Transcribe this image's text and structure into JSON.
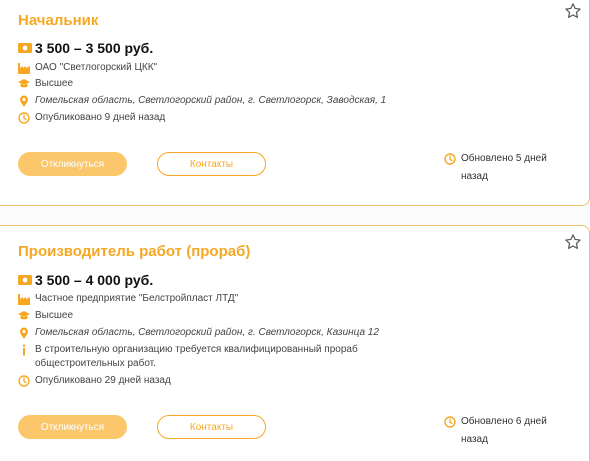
{
  "vacancies": [
    {
      "title": "Начальник",
      "salary": "3 500 – 3 500 руб.",
      "company": "ОАО \"Светлогорский ЦКК\"",
      "education": "Высшее",
      "address": "Гомельская область, Светлогорский район, г. Светлогорск, Заводская, 1",
      "published": "Опубликовано 9 дней назад",
      "apply_label": "Откликнуться",
      "contacts_label": "Контакты",
      "updated_line1": "Обновлено 5 дней",
      "updated_line2": "назад"
    },
    {
      "title": "Производитель работ (прораб)",
      "salary": "3 500 – 4 000 руб.",
      "company": "Частное предприятие \"Белстройпласт ЛТД\"",
      "education": "Высшее",
      "address": "Гомельская область, Светлогорский район, г. Светлогорск, Казинца 12",
      "description_line1": "В строительную организацию требуется квалифицированный прораб",
      "description_line2": "общестроительных работ.",
      "published": "Опубликовано 29 дней назад",
      "apply_label": "Откликнуться",
      "contacts_label": "Контакты",
      "updated_line1": "Обновлено 6 дней",
      "updated_line2": "назад"
    }
  ],
  "colors": {
    "accent": "#f6a823",
    "button_fill": "#fbc76a",
    "border": "#f2c07a"
  },
  "icons": [
    "star-icon",
    "money-icon",
    "factory-icon",
    "graduation-cap-icon",
    "location-pin-icon",
    "info-icon",
    "clock-icon"
  ]
}
